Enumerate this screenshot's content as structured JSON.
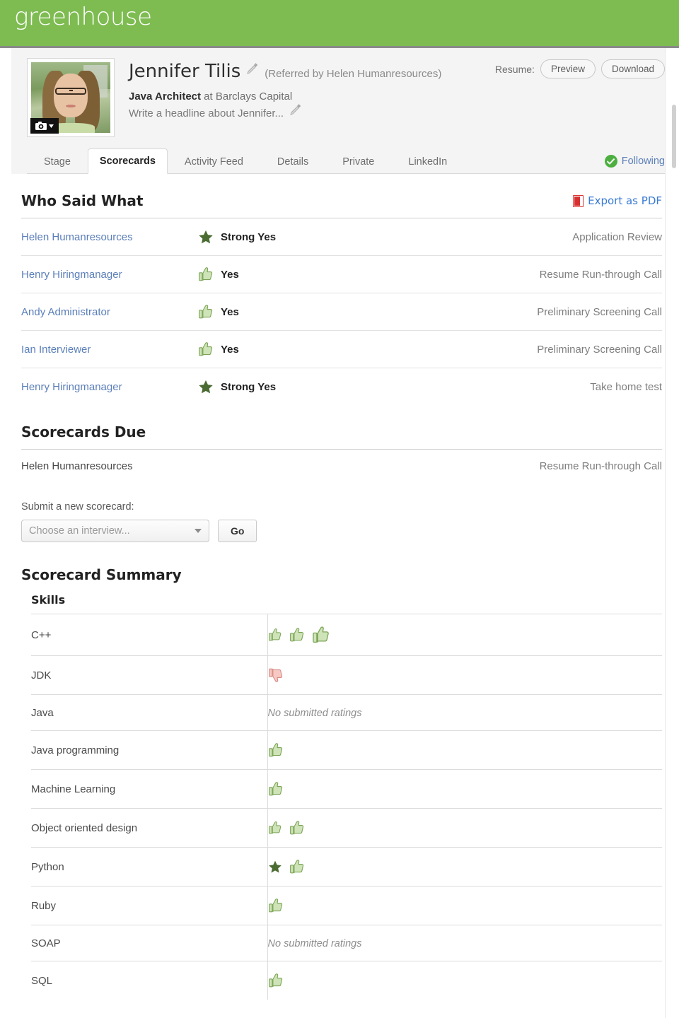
{
  "brand": {
    "logo_text": "greenhouse",
    "header_color": "#7ebc52"
  },
  "candidate": {
    "name": "Jennifer Tilis",
    "referred_by": "(Referred by Helen Humanresources)",
    "job_title": "Java Architect",
    "job_at": " at Barclays Capital",
    "headline_placeholder": "Write a headline about Jennifer...",
    "avatar_alt": "Jennifer Tilis photo",
    "camera_icon": "camera-icon",
    "edit_icon": "pencil-icon"
  },
  "resume": {
    "label": "Resume:",
    "preview_label": "Preview",
    "download_label": "Download"
  },
  "tabs": [
    {
      "label": "Stage",
      "active": false
    },
    {
      "label": "Scorecards",
      "active": true
    },
    {
      "label": "Activity Feed",
      "active": false
    },
    {
      "label": "Details",
      "active": false
    },
    {
      "label": "Private",
      "active": false
    },
    {
      "label": "LinkedIn",
      "active": false
    }
  ],
  "following": {
    "label": "Following",
    "icon": "check-circle-icon",
    "color": "#4caf3f"
  },
  "who_said_what": {
    "title": "Who Said What",
    "export_label": "Export as PDF",
    "export_icon": "pdf-icon",
    "rows": [
      {
        "person": "Helen Humanresources",
        "verdict": "Strong Yes",
        "icon": "star-icon",
        "stage": "Application Review"
      },
      {
        "person": "Henry Hiringmanager",
        "verdict": "Yes",
        "icon": "thumb-up-icon",
        "stage": "Resume Run-through Call"
      },
      {
        "person": "Andy Administrator",
        "verdict": "Yes",
        "icon": "thumb-up-icon",
        "stage": "Preliminary Screening Call"
      },
      {
        "person": "Ian Interviewer",
        "verdict": "Yes",
        "icon": "thumb-up-icon",
        "stage": "Preliminary Screening Call"
      },
      {
        "person": "Henry Hiringmanager",
        "verdict": "Strong Yes",
        "icon": "star-icon",
        "stage": "Take home test"
      }
    ]
  },
  "scorecards_due": {
    "title": "Scorecards Due",
    "rows": [
      {
        "person": "Helen Humanresources",
        "stage": "Resume Run-through Call"
      }
    ]
  },
  "submit_form": {
    "label": "Submit a new scorecard:",
    "select_value": "Choose an interview...",
    "go_label": "Go"
  },
  "scorecard_summary": {
    "title": "Scorecard Summary",
    "skills_header": "Skills",
    "no_ratings_text": "No submitted ratings",
    "rows": [
      {
        "skill": "C++",
        "ratings": [
          "thumb-up-icon",
          "thumb-up-icon",
          "thumb-up-icon"
        ]
      },
      {
        "skill": "JDK",
        "ratings": [
          "thumb-down-icon"
        ]
      },
      {
        "skill": "Java",
        "ratings": []
      },
      {
        "skill": "Java programming",
        "ratings": [
          "thumb-up-icon"
        ]
      },
      {
        "skill": "Machine Learning",
        "ratings": [
          "thumb-up-icon"
        ]
      },
      {
        "skill": "Object oriented design",
        "ratings": [
          "thumb-up-icon",
          "thumb-up-icon"
        ]
      },
      {
        "skill": "Python",
        "ratings": [
          "star-icon",
          "thumb-up-icon"
        ]
      },
      {
        "skill": "Ruby",
        "ratings": [
          "thumb-up-icon"
        ]
      },
      {
        "skill": "SOAP",
        "ratings": []
      },
      {
        "skill": "SQL",
        "ratings": [
          "thumb-up-icon"
        ]
      }
    ]
  },
  "colors": {
    "brand_green": "#7ebc52",
    "thumb_up": "#cfe3b8",
    "thumb_up_stroke": "#7aa455",
    "thumb_down": "#f6c9c4",
    "thumb_down_stroke": "#d98b83",
    "star": "#4a6b32",
    "link_blue": "#5b7fb9",
    "pdf_red": "#d63030"
  }
}
